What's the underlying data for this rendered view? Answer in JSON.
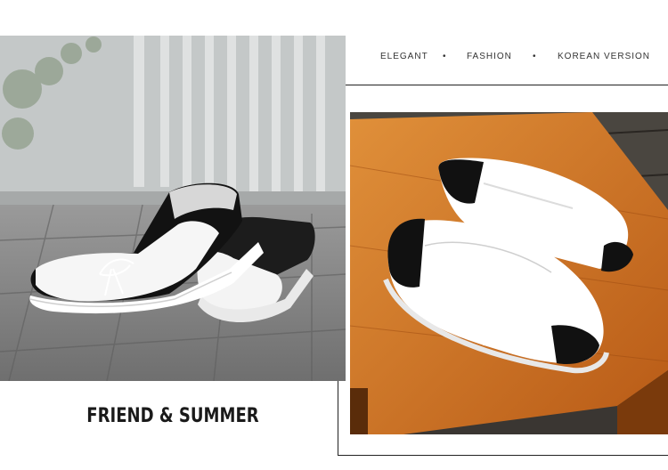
{
  "tagline": {
    "word1": "ELEGANT",
    "sep1": "•",
    "word2": "FASHION",
    "sep2": "•",
    "word3": "KOREAN VERSION"
  },
  "caption": "FRIEND & SUMMER",
  "colors": {
    "frame_line": "#222222",
    "caption_text": "#1a1a1a",
    "wood_bench": "#c96a1f",
    "pavement": "#8a8a8a"
  }
}
